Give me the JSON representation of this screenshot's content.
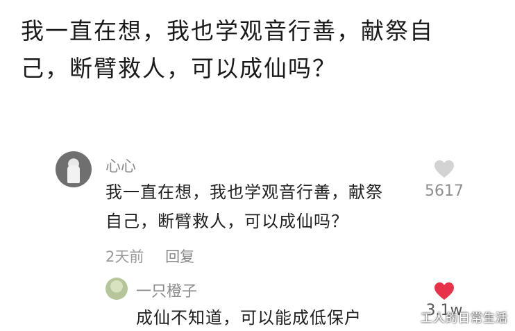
{
  "headline": {
    "line1": "我一直在想，我也学观音行善，献祭自",
    "line2": "己，断臂救人，可以成仙吗？"
  },
  "comment": {
    "author": "心心",
    "text_line1": "我一直在想，我也学观音行善，献祭",
    "text_line2": "自己，断臂救人，可以成仙吗？",
    "time": "2天前",
    "reply_label": "回复",
    "likes": "5617",
    "liked": false,
    "heart_color": "#d3d3d3"
  },
  "reply": {
    "author": "一只橙子",
    "text": "成仙不知道，可以能成低保户",
    "likes": "3.1w",
    "liked": true,
    "heart_color": "#e8324a"
  },
  "watermark": "工人的日常生活"
}
